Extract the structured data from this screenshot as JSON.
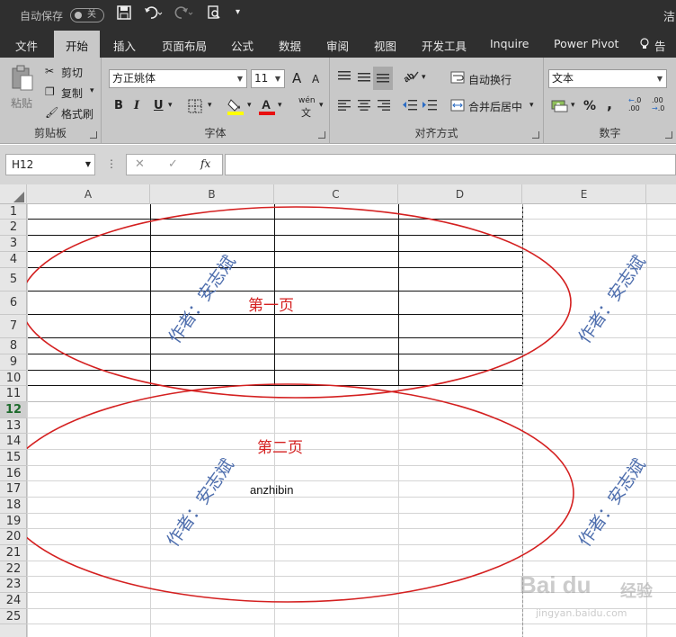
{
  "titlebar": {
    "autosave": "自动保存",
    "toggle": "关",
    "title_partial": "洁"
  },
  "tabs": [
    "文件",
    "开始",
    "插入",
    "页面布局",
    "公式",
    "数据",
    "审阅",
    "视图",
    "开发工具",
    "Inquire",
    "Power Pivot",
    "告诉"
  ],
  "ribbon": {
    "clipboard": {
      "paste": "粘贴",
      "cut": "剪切",
      "copy": "复制",
      "painter": "格式刷",
      "label": "剪贴板"
    },
    "font": {
      "name": "方正姚体",
      "size": "11",
      "bold": "B",
      "italic": "I",
      "underline": "U",
      "wen": "wén",
      "wen2": "文",
      "label": "字体",
      "grow": "A",
      "shrink": "A"
    },
    "align": {
      "wrap": "自动换行",
      "merge": "合并后居中",
      "label": "对齐方式"
    },
    "number": {
      "format": "文本",
      "percent": "%",
      "comma": ",",
      "inc": ".00",
      "dec": ".00",
      "label": "数字"
    }
  },
  "formula": {
    "namebox": "H12",
    "fx": "fx",
    "cancel": "✕",
    "enter": "✓"
  },
  "columns": [
    "A",
    "B",
    "C",
    "D",
    "E"
  ],
  "rows": [
    "1",
    "2",
    "3",
    "4",
    "5",
    "6",
    "7",
    "8",
    "9",
    "10",
    "11",
    "12",
    "13",
    "14",
    "15",
    "16",
    "17",
    "18",
    "19",
    "20",
    "21",
    "22",
    "23",
    "24",
    "25"
  ],
  "selected_row": "12",
  "sheet": {
    "page1": "第一页",
    "page2": "第二页",
    "author_text": "anzhibin",
    "watermark": "作者：安志斌"
  },
  "baidu": {
    "logo": "Bai du",
    "jingyan": "经验",
    "url": "jingyan.baidu.com"
  },
  "colors": {
    "accent_red": "#d42020",
    "watermark": "#4f6fae",
    "ribbon": "#c8c8c8",
    "titlebar": "#2f2f2f"
  }
}
